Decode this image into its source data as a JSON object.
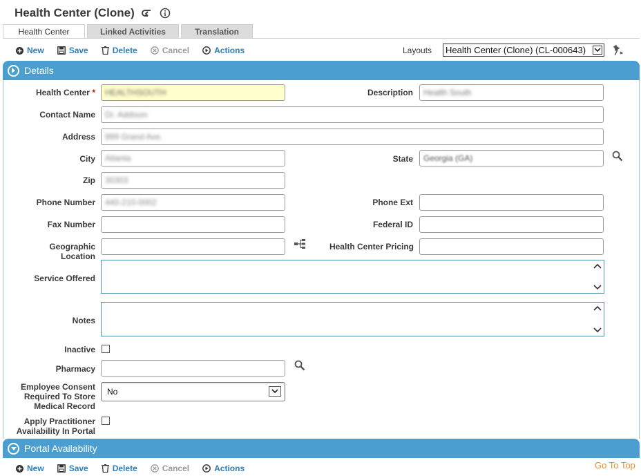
{
  "header": {
    "title": "Health Center (Clone)",
    "back_icon": "return-arrow-icon",
    "info_icon": "info-icon"
  },
  "tabs": [
    {
      "label": "Health Center",
      "active": true
    },
    {
      "label": "Linked Activities",
      "active": false
    },
    {
      "label": "Translation",
      "active": false
    }
  ],
  "toolbar": {
    "new": "New",
    "save": "Save",
    "delete": "Delete",
    "cancel": "Cancel",
    "actions": "Actions"
  },
  "layouts": {
    "label": "Layouts",
    "selected": "Health Center (Clone) (CL-000643)"
  },
  "sections": {
    "details": "Details",
    "portal": "Portal Availability"
  },
  "form": {
    "health_center": {
      "label": "Health Center",
      "value": "HEALTHSOUTH"
    },
    "description": {
      "label": "Description",
      "value": "Health South"
    },
    "contact_name": {
      "label": "Contact Name",
      "value": "Dr. Addison"
    },
    "address": {
      "label": "Address",
      "value": "999 Grand Ave."
    },
    "city": {
      "label": "City",
      "value": "Atlanta"
    },
    "state": {
      "label": "State",
      "value": "Georgia (GA)"
    },
    "zip": {
      "label": "Zip",
      "value": "30303"
    },
    "phone_number": {
      "label": "Phone Number",
      "value": "440-210-0002"
    },
    "phone_ext": {
      "label": "Phone Ext",
      "value": ""
    },
    "fax_number": {
      "label": "Fax Number",
      "value": ""
    },
    "federal_id": {
      "label": "Federal ID",
      "value": ""
    },
    "geographic_location": {
      "label": "Geographic Location",
      "value": ""
    },
    "health_center_pricing": {
      "label": "Health Center Pricing",
      "value": ""
    },
    "service_offered": {
      "label": "Service Offered",
      "value": ""
    },
    "notes": {
      "label": "Notes",
      "value": ""
    },
    "inactive": {
      "label": "Inactive",
      "checked": false
    },
    "pharmacy": {
      "label": "Pharmacy",
      "value": ""
    },
    "employee_consent": {
      "label_1": "Employee Consent",
      "label_2": "Required To Store",
      "label_3": "Medical Record",
      "value": "No"
    },
    "apply_practitioner": {
      "label_1": "Apply Practitioner",
      "label_2": "Availability In Portal",
      "checked": false
    }
  },
  "footer": {
    "goto_top": "Go To Top"
  },
  "colors": {
    "accent": "#4a9fd0",
    "link": "#2d7dbb",
    "required": "#d40000",
    "highlight_input": "#ffffcc",
    "goto_top": "#f08a32"
  }
}
